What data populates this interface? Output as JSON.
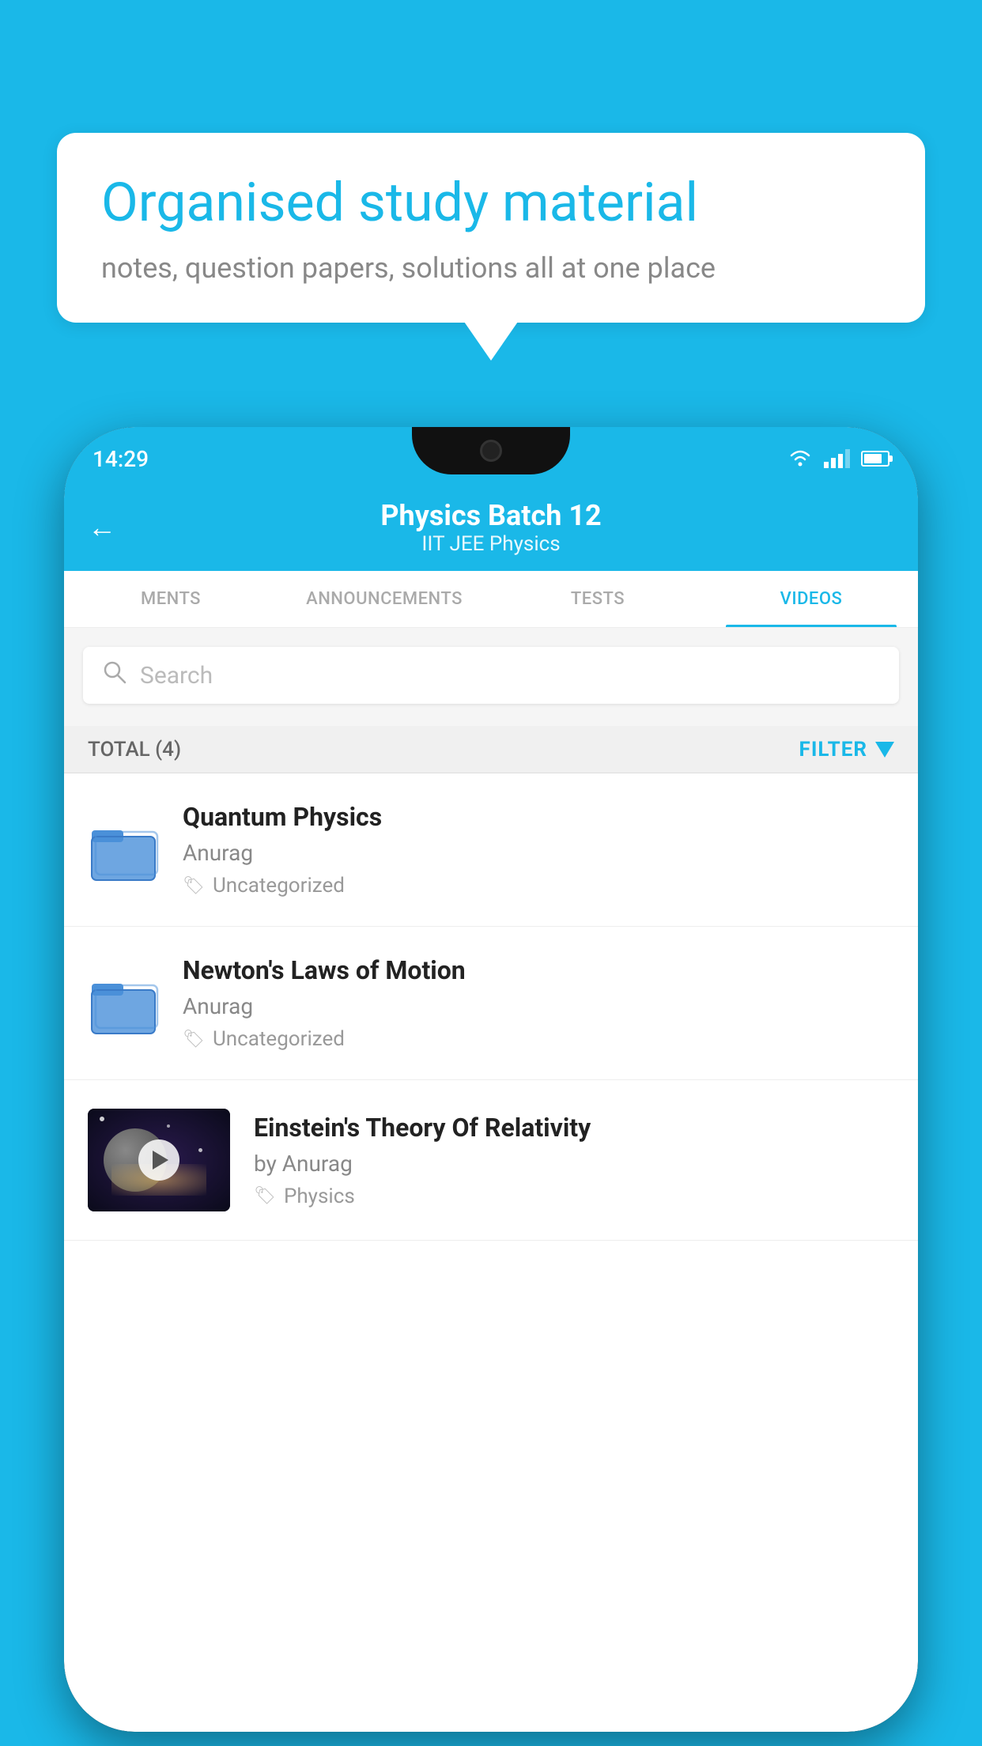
{
  "background": {
    "color": "#1ab8e8"
  },
  "bubble": {
    "title": "Organised study material",
    "subtitle": "notes, question papers, solutions all at one place"
  },
  "status_bar": {
    "time": "14:29",
    "wifi": "wifi",
    "signal": "signal",
    "battery": "battery"
  },
  "header": {
    "title": "Physics Batch 12",
    "subtitle": "IIT JEE   Physics",
    "back_label": "←"
  },
  "tabs": [
    {
      "label": "MENTS",
      "active": false
    },
    {
      "label": "ANNOUNCEMENTS",
      "active": false
    },
    {
      "label": "TESTS",
      "active": false
    },
    {
      "label": "VIDEOS",
      "active": true
    }
  ],
  "search": {
    "placeholder": "Search"
  },
  "filter_bar": {
    "total_label": "TOTAL (4)",
    "filter_label": "FILTER"
  },
  "videos": [
    {
      "title": "Quantum Physics",
      "author": "Anurag",
      "tag": "Uncategorized",
      "type": "folder"
    },
    {
      "title": "Newton's Laws of Motion",
      "author": "Anurag",
      "tag": "Uncategorized",
      "type": "folder"
    },
    {
      "title": "Einstein's Theory Of Relativity",
      "author": "by Anurag",
      "tag": "Physics",
      "type": "video"
    }
  ]
}
